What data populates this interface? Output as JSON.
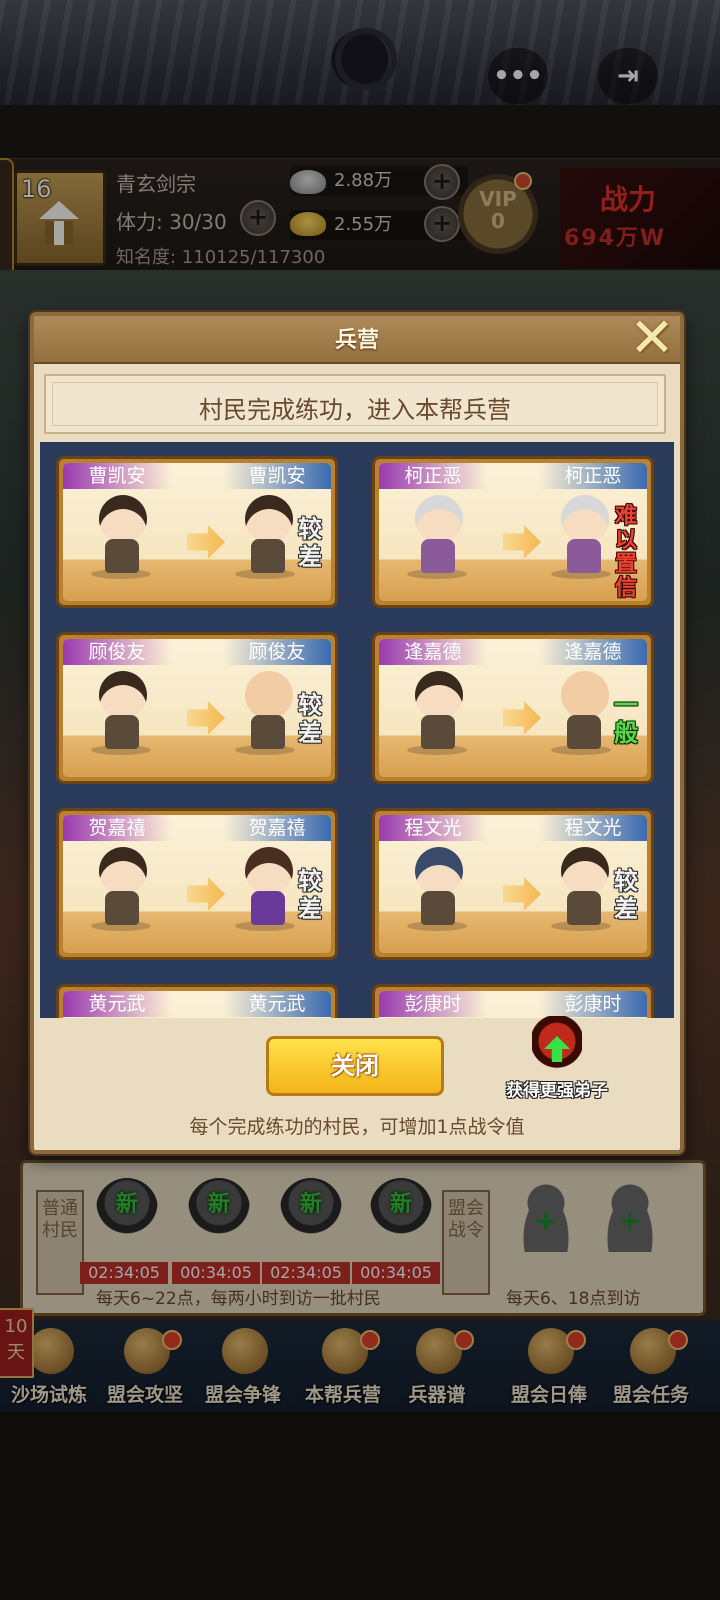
{
  "top_bar": {
    "more_icon": "ellipsis-icon",
    "exit_icon": "exit-icon",
    "more_glyph": "•••",
    "exit_glyph": "⇥"
  },
  "player": {
    "level": "16",
    "sect_name": "青玄剑宗",
    "stamina": "体力: 30/30",
    "fame": "知名度: 110125/117300",
    "silver": "2.88万",
    "gold": "2.55万",
    "vip_label": "VIP",
    "vip_level": "0",
    "power_title": "战力",
    "power_value": "69​4万W"
  },
  "modal": {
    "title": "兵营",
    "close_glyph": "✕",
    "subtitle": "村民完成练功，进入本帮兵营",
    "close_button": "关闭",
    "get_stronger": "获得更强弟子",
    "footer_note": "每个完成练功的村民，可增加1点战令值"
  },
  "cards": [
    {
      "from": "曹凯安",
      "to": "曹凯安",
      "grade": "较差",
      "grade_type": "poor",
      "from_style": "young",
      "to_style": "young"
    },
    {
      "from": "柯正恶",
      "to": "柯正恶",
      "grade": "难以置信",
      "grade_type": "bad",
      "from_style": "old",
      "to_style": "old"
    },
    {
      "from": "顾俊友",
      "to": "顾俊友",
      "grade": "较差",
      "grade_type": "poor",
      "from_style": "young",
      "to_style": "bald"
    },
    {
      "from": "逢嘉德",
      "to": "逢嘉德",
      "grade": "一般",
      "grade_type": "normal",
      "from_style": "young",
      "to_style": "bald"
    },
    {
      "from": "贺嘉禧",
      "to": "贺嘉禧",
      "grade": "较差",
      "grade_type": "poor",
      "from_style": "young",
      "to_style": "female"
    },
    {
      "from": "程文光",
      "to": "程文光",
      "grade": "较差",
      "grade_type": "poor",
      "from_style": "hat",
      "to_style": "young"
    },
    {
      "from": "黄元武",
      "to": "黄元武",
      "grade": "",
      "grade_type": "poor",
      "from_style": "young",
      "to_style": "young"
    },
    {
      "from": "彭康时",
      "to": "彭康时",
      "grade": "",
      "grade_type": "poor",
      "from_style": "young",
      "to_style": "young"
    }
  ],
  "recruit": {
    "left_label": "普通村民",
    "mid_label": "盟会战令",
    "new_badge": "新",
    "timers": [
      "02:34:05",
      "00:34:05",
      "02:34:05",
      "00:34:05"
    ],
    "note_left": "每天6~22点，每两小时到访一批村民",
    "note_right": "每天6、18点到访",
    "plus": "+"
  },
  "nav": {
    "days": "10天",
    "items": [
      {
        "label": "沙场试炼",
        "icon": "helmet-icon",
        "dot": false
      },
      {
        "label": "盟会攻坚",
        "icon": "banner-icon",
        "dot": true
      },
      {
        "label": "盟会争锋",
        "icon": "shield-icon",
        "dot": false
      },
      {
        "label": "本帮兵营",
        "icon": "warrior-icon",
        "dot": true
      },
      {
        "label": "兵器谱",
        "icon": "scroll-icon",
        "dot": true
      },
      {
        "label": "盟会日俸",
        "icon": "treasure-icon",
        "dot": true
      },
      {
        "label": "盟会任务",
        "icon": "horn-icon",
        "dot": true
      }
    ]
  }
}
